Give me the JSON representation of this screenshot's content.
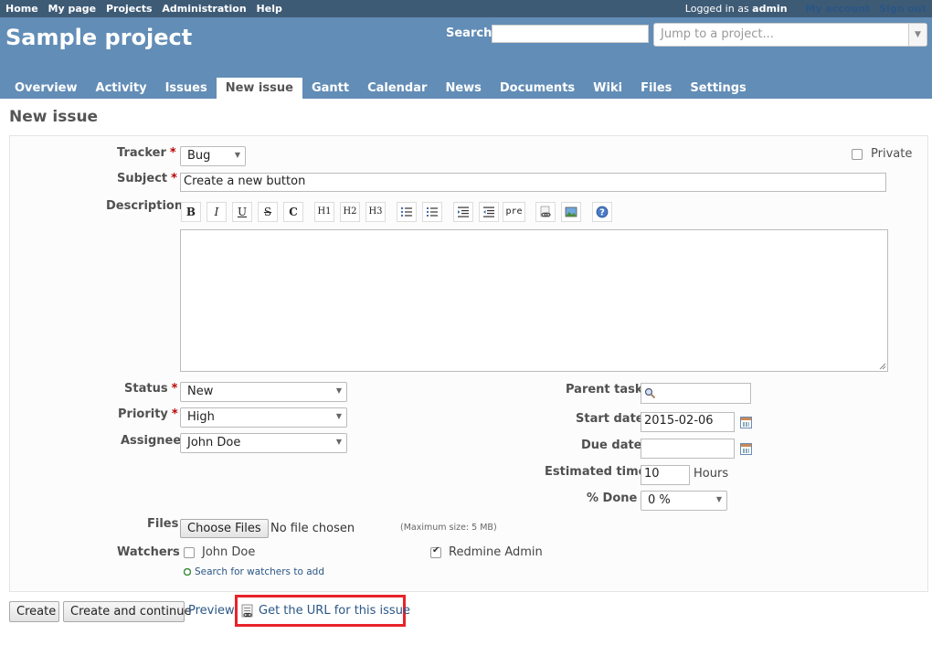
{
  "top_menu": {
    "left": [
      "Home",
      "My page",
      "Projects",
      "Administration",
      "Help"
    ],
    "logged_in_prefix": "Logged in as",
    "logged_in_user": "admin",
    "my_account": "My account",
    "sign_out": "Sign out"
  },
  "header": {
    "project": "Sample project",
    "search_label": "Search:",
    "search_value": "",
    "jump_placeholder": "Jump to a project..."
  },
  "tabs": [
    {
      "label": "Overview",
      "selected": false
    },
    {
      "label": "Activity",
      "selected": false
    },
    {
      "label": "Issues",
      "selected": false
    },
    {
      "label": "New issue",
      "selected": true
    },
    {
      "label": "Gantt",
      "selected": false
    },
    {
      "label": "Calendar",
      "selected": false
    },
    {
      "label": "News",
      "selected": false
    },
    {
      "label": "Documents",
      "selected": false
    },
    {
      "label": "Wiki",
      "selected": false
    },
    {
      "label": "Files",
      "selected": false
    },
    {
      "label": "Settings",
      "selected": false
    }
  ],
  "page_title": "New issue",
  "form": {
    "tracker_label": "Tracker",
    "tracker_value": "Bug",
    "private_label": "Private",
    "subject_label": "Subject",
    "subject_value": "Create a new button",
    "description_label": "Description",
    "toolbar": {
      "bold": "B",
      "italic": "I",
      "underline": "U",
      "strike": "S",
      "code": "C",
      "h1": "H1",
      "h2": "H2",
      "h3": "H3",
      "pre": "pre",
      "help": "?"
    },
    "status_label": "Status",
    "status_value": "New",
    "priority_label": "Priority",
    "priority_value": "High",
    "assignee_label": "Assignee",
    "assignee_value": "John Doe",
    "parent_task_label": "Parent task",
    "start_date_label": "Start date",
    "start_date_value": "2015-02-06",
    "due_date_label": "Due date",
    "due_date_value": "",
    "estimated_time_label": "Estimated time",
    "estimated_time_value": "10",
    "hours_label": "Hours",
    "done_label": "% Done",
    "done_value": "0 %",
    "files_label": "Files",
    "choose_files": "Choose Files",
    "no_file": "No file chosen",
    "max_size": "(Maximum size: 5 MB)",
    "watchers_label": "Watchers",
    "watchers": [
      {
        "name": "John Doe",
        "checked": false
      },
      {
        "name": "Redmine Admin",
        "checked": true
      }
    ],
    "search_watchers": "Search for watchers to add"
  },
  "actions": {
    "create": "Create",
    "create_continue": "Create and continue",
    "preview": "Preview",
    "get_url": "Get the URL for this issue"
  },
  "colors": {
    "top_menu": "#3e5b76",
    "header": "#628db6",
    "highlight": "#e8232a",
    "link": "#2a5685",
    "required": "#bb0000"
  }
}
